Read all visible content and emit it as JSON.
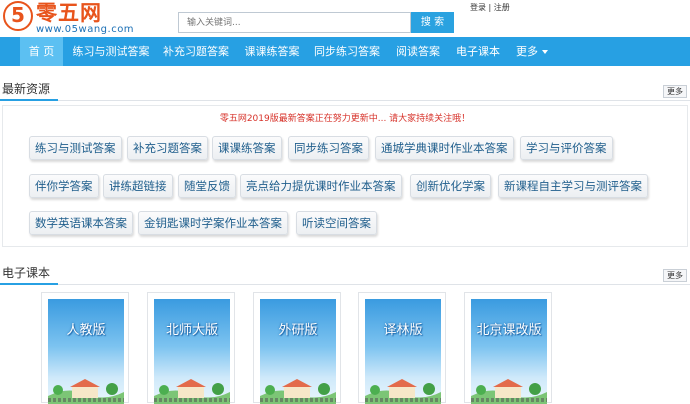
{
  "logo": {
    "mark": "5",
    "name": "零五网",
    "url": "www.05wang.com"
  },
  "search": {
    "placeholder": "输入关键词...",
    "button": "搜 索"
  },
  "auth": {
    "text": "登录 | 注册"
  },
  "nav": {
    "items": [
      "首 页",
      "练习与测试答案",
      "补充习题答案",
      "课课练答案",
      "同步练习答案",
      "阅读答案",
      "电子课本",
      "更多"
    ],
    "active_index": 0
  },
  "sections": {
    "latest": {
      "title": "最新资源",
      "more": "更多"
    },
    "ebook": {
      "title": "电子课本",
      "more": "更多"
    }
  },
  "notice": "零五网2019版最新答案正在努力更新中... 请大家持续关注哦！",
  "tags": [
    "练习与测试答案",
    "补充习题答案",
    "课课练答案",
    "同步练习答案",
    "通城学典课时作业本答案",
    "学习与评价答案",
    "伴你学答案",
    "讲练超链接",
    "随堂反馈",
    "亮点给力提优课时作业本答案",
    "创新优化学案",
    "新课程自主学习与测评答案",
    "数学英语课本答案",
    "金钥匙课时学案作业本答案",
    "听读空间答案"
  ],
  "books": [
    "人教版",
    "北师大版",
    "外研版",
    "译林版",
    "北京课改版"
  ],
  "colors": {
    "nav": "#27a0e3",
    "nav_active": "#5cc0f2",
    "notice": "#d7332b",
    "logo": "#e8541c"
  }
}
